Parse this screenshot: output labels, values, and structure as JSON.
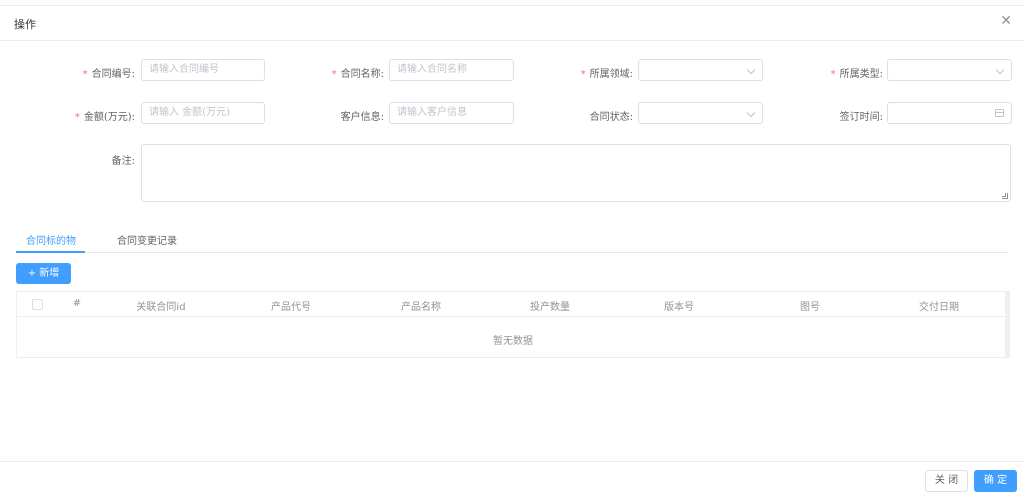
{
  "dialog": {
    "title": "操作",
    "close_icon": "close-icon"
  },
  "form": {
    "contract_no": {
      "label": "合同编号:",
      "placeholder": "请输入合同编号",
      "required": true
    },
    "contract_name": {
      "label": "合同名称:",
      "placeholder": "请输入合同名称",
      "required": true
    },
    "domain": {
      "label": "所属领域:",
      "value": "",
      "required": true
    },
    "type": {
      "label": "所属类型:",
      "value": "",
      "required": true
    },
    "amount": {
      "label": "金额(万元):",
      "placeholder": "请输入 金额(万元)",
      "required": true
    },
    "customer": {
      "label": "客户信息:",
      "placeholder": "请输入客户信息",
      "required": false
    },
    "status": {
      "label": "合同状态:",
      "value": "",
      "required": false
    },
    "sign_date": {
      "label": "签订时间:",
      "value": "",
      "required": false
    },
    "remark": {
      "label": "备注:",
      "value": ""
    },
    "required_mark": "*"
  },
  "tabs": [
    {
      "label": "合同标的物",
      "active": true
    },
    {
      "label": "合同变更记录",
      "active": false
    }
  ],
  "toolbar": {
    "add_label": "+ 新增"
  },
  "table": {
    "columns": [
      "#",
      "关联合同id",
      "产品代号",
      "产品名称",
      "投产数量",
      "版本号",
      "图号",
      "交付日期"
    ],
    "rows": [],
    "empty_text": "暂无数据"
  },
  "footer": {
    "close_label": "关 闭",
    "confirm_label": "确 定"
  },
  "colors": {
    "primary": "#409eff",
    "required": "#f56c6c",
    "border": "#dcdfe6"
  }
}
